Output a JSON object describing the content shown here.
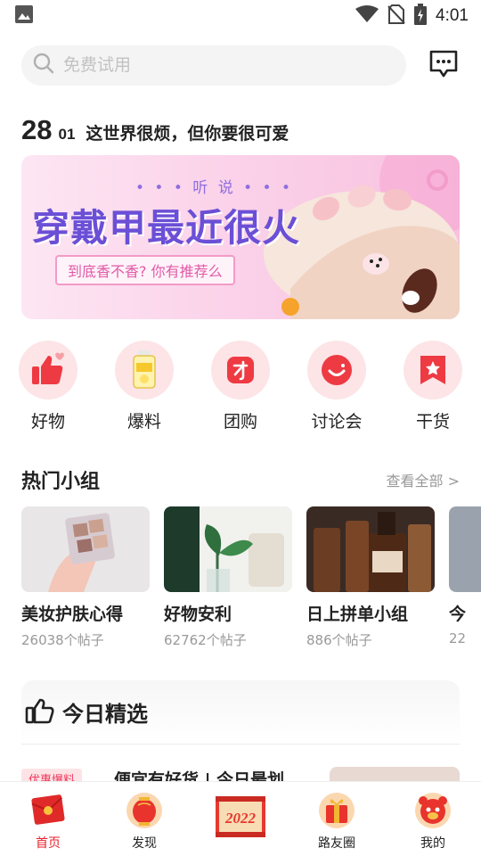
{
  "status": {
    "time": "4:01"
  },
  "search": {
    "placeholder": "免费试用"
  },
  "daily": {
    "day": "28",
    "month": "01",
    "quote": "这世界很烦，但你要很可爱"
  },
  "banner": {
    "subtitle": "• • • 听 说 • • •",
    "title": "穿戴甲最近很火",
    "pill": "到底香不香? 你有推荐么"
  },
  "categories": [
    {
      "label": "好物",
      "icon": "thumbs-up-icon"
    },
    {
      "label": "爆料",
      "icon": "drink-bottle-icon"
    },
    {
      "label": "团购",
      "icon": "group-buy-icon"
    },
    {
      "label": "讨论会",
      "icon": "smile-chat-icon"
    },
    {
      "label": "干货",
      "icon": "bookmark-star-icon"
    }
  ],
  "hot_groups": {
    "title": "热门小组",
    "more": "查看全部 >",
    "items": [
      {
        "name": "美妆护肤心得",
        "count": "26038个帖子"
      },
      {
        "name": "好物安利",
        "count": "62762个帖子"
      },
      {
        "name": "日上拼单小组",
        "count": "886个帖子"
      },
      {
        "name": "今",
        "count": "22"
      }
    ]
  },
  "today_picks": {
    "title": "今日精选"
  },
  "article": {
    "tag": "优惠爆料",
    "title": "便宜有好货 | 今日最划"
  },
  "tabbar": {
    "items": [
      {
        "label": "首页",
        "active": true
      },
      {
        "label": "发现"
      },
      {
        "center_badge": "2022"
      },
      {
        "label": "路友圈"
      },
      {
        "label": "我的"
      }
    ]
  },
  "colors": {
    "accent": "#e8222f",
    "icon_bg": "#fde4e6",
    "banner_purple": "#6b4fd6"
  }
}
